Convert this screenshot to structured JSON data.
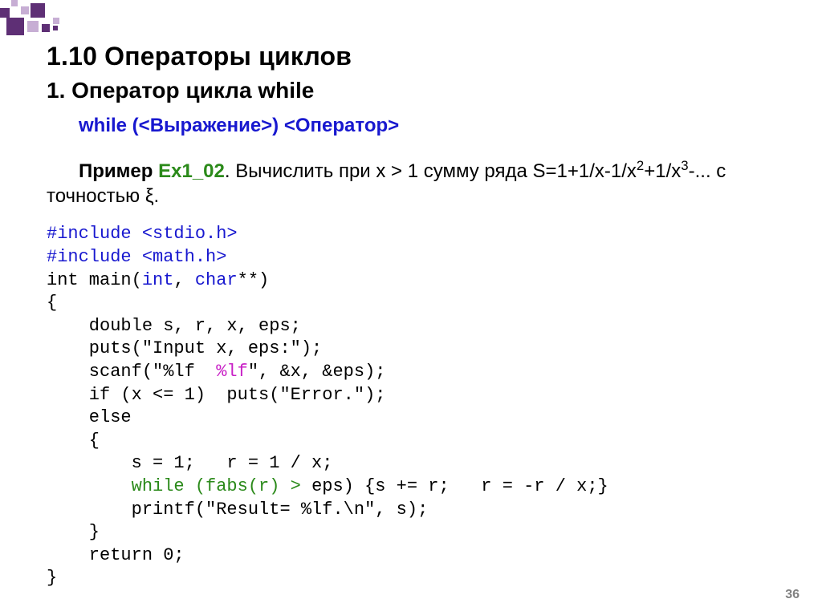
{
  "heading_main": "1.10 Операторы циклов",
  "heading_sub": "1. Оператор цикла while",
  "syntax_line": "while (<Выражение>) <Оператор>",
  "example": {
    "prefix_bold": "Пример ",
    "label_green": "Ex1_02",
    "dot": ". ",
    "rest_a": "Вычислить при x > 1 сумму ряда S=1+1/x-1/x",
    "sup2": "2",
    "rest_b": "+1/x",
    "sup3": "3",
    "rest_c": "-... с точностью ξ."
  },
  "code": {
    "l01_a": "#include <stdio.h>",
    "l02_a": "#include <math.h>",
    "l03_a": "int main(",
    "l03_b": "int",
    "l03_c": ", ",
    "l03_d": "char",
    "l03_e": "**) ",
    "l04_a": "{",
    "l05_a": "    double s, r, x, eps;",
    "l06_a": "    puts(\"Input x, eps:\");",
    "l07_a": "    scanf(\"%lf  ",
    "l07_b": "%lf",
    "l07_c": "\", &x, &eps);",
    "l08_a": "    if (x <= 1)  puts(\"Error.\");",
    "l09_a": "    else",
    "l10_a": "    {",
    "l11_a": "        s = 1;   r = 1 / x;",
    "l12_a": "        while (fabs(r) > ",
    "l12_b": "eps) {s += r;   r = -r / x;}",
    "l13_a": "        printf(\"Result= %lf.\\n\", s);",
    "l14_a": "    }",
    "l15_a": "    return 0;",
    "l16_a": "}"
  },
  "page_number": "36"
}
